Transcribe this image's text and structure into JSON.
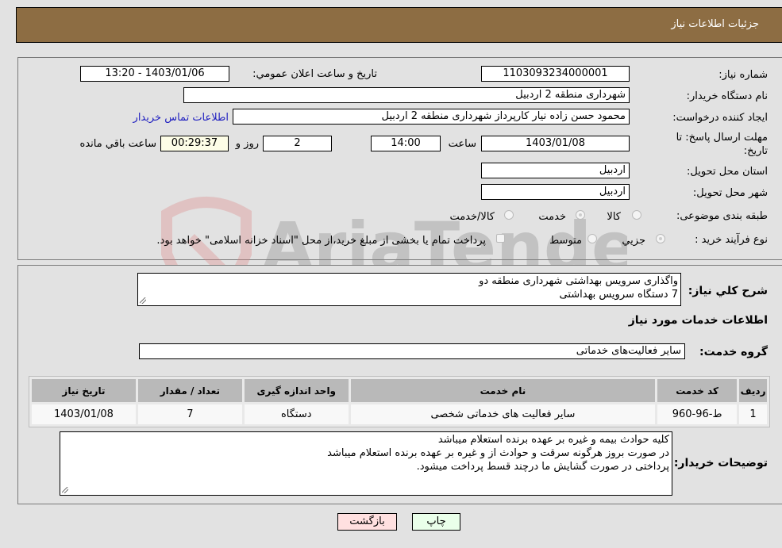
{
  "header": {
    "title": "جزئیات اطلاعات نیاز"
  },
  "form": {
    "need_number": {
      "label": "شماره نیاز:",
      "value": "1103093234000001"
    },
    "announce_datetime": {
      "label": "تاریخ و ساعت اعلان عمومي:",
      "value": "1403/01/06 - 13:20"
    },
    "buyer_org": {
      "label": "نام دستگاه خريدار:",
      "value": "شهرداری منطقه 2 اردبیل"
    },
    "requester": {
      "label": "ايجاد کننده درخواست:",
      "value": "محمود حسن زاده نیار کارپرداز شهرداری منطقه 2 اردبیل",
      "contact_link": "اطلاعات تماس خريدار"
    },
    "deadline": {
      "label": "مهلت ارسال پاسخ: تا تاریخ:",
      "date": "1403/01/08",
      "time_label": "ساعت",
      "time": "14:00",
      "days": "2",
      "days_label": "روز و",
      "remaining": "00:29:37",
      "remaining_label": "ساعت باقي مانده"
    },
    "province": {
      "label": "استان محل تحویل:",
      "value": "اردبیل"
    },
    "city": {
      "label": "شهر محل تحویل:",
      "value": "اردبیل"
    },
    "category": {
      "label": "طبقه بندی موضوعی:",
      "options": [
        "کالا",
        "خدمت",
        "کالا/خدمت"
      ],
      "selected": "خدمت"
    },
    "purchase_type": {
      "label": "نوع فرآیند خرید :",
      "options": [
        "جزيي",
        "متوسط"
      ],
      "selected": "جزيي",
      "payment_note": "پرداخت تمام يا بخشی از مبلغ خرید،از محل \"اسناد خزانه اسلامی\" خواهد بود."
    }
  },
  "description": {
    "label": "شرح کلي نياز:",
    "lines": [
      "واگذاری سرویس بهداشتی شهرداری منطقه دو",
      "7 دستگاه  سرویس بهداشتی"
    ]
  },
  "services_section": {
    "title": "اطلاعات خدمات مورد نياز",
    "group_label": "گروه خدمت:",
    "group_value": "سایر فعالیت‌های خدماتی",
    "table": {
      "headers": [
        "رديف",
        "کد خدمت",
        "نام خدمت",
        "واحد اندازه گيری",
        "تعداد / مقدار",
        "تاريخ نياز"
      ],
      "rows": [
        [
          "1",
          "ط-96-960",
          "سایر فعالیت های خدماتی شخصی",
          "دستگاه",
          "7",
          "1403/01/08"
        ]
      ]
    }
  },
  "buyer_notes": {
    "label": "توضيحات خريدار:",
    "lines": [
      "کلیه حوادث بیمه و غیره بر عهده برنده استعلام میباشد",
      "در صورت بروز هرگونه سرقت و حوادث  از و غیره بر عهده برنده استعلام میباشد",
      "پرداختی در صورت گشایش ما درچند قسط پرداخت میشود."
    ]
  },
  "buttons": {
    "print": "چاپ",
    "back": "بازگشت"
  },
  "colors": {
    "header_bg": "#8d6d43",
    "print_bg": "#eaffea",
    "back_bg": "#ffe0e0"
  },
  "watermark": {
    "text": "AriaTender.neT"
  }
}
